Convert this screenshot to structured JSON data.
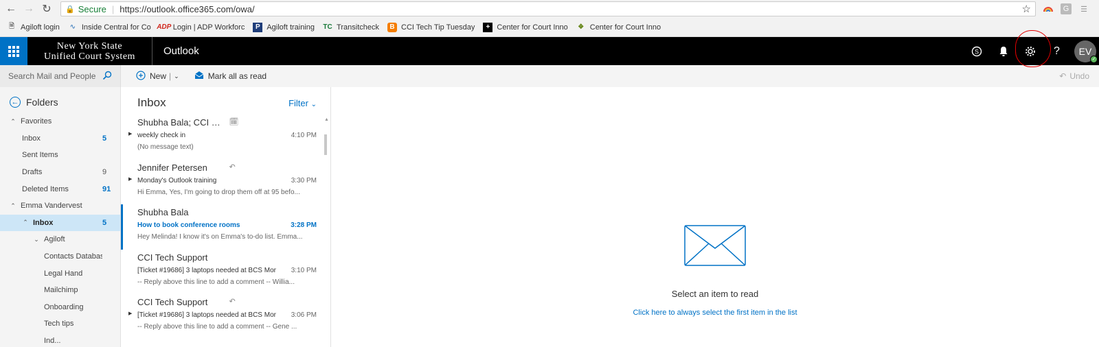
{
  "browser": {
    "secure_label": "Secure",
    "url": "https://outlook.office365.com/owa/",
    "bookmarks": [
      {
        "label": "Agiloft login",
        "icon": "page-icon"
      },
      {
        "label": "Inside Central for Co",
        "icon": "inside-central-icon"
      },
      {
        "label": "Login | ADP Workforc",
        "icon": "adp-icon"
      },
      {
        "label": "Agiloft training",
        "icon": "p-logo-icon"
      },
      {
        "label": "Transitcheck",
        "icon": "tc-icon"
      },
      {
        "label": "CCI Tech Tip Tuesday",
        "icon": "blogger-icon"
      },
      {
        "label": "Center for Court Inno",
        "icon": "plus-icon"
      },
      {
        "label": "Center for Court Inno",
        "icon": "ccci-icon"
      }
    ]
  },
  "suite": {
    "org_line1": "New York State",
    "org_line2": "Unified Court System",
    "app_name": "Outlook",
    "avatar_initials": "EV"
  },
  "commandbar": {
    "search_placeholder": "Search Mail and People",
    "new_label": "New",
    "mark_all_label": "Mark all as read",
    "undo_label": "Undo"
  },
  "folders": {
    "header": "Folders",
    "items": [
      {
        "label": "Favorites",
        "count": "",
        "level": 1,
        "chev": "^"
      },
      {
        "label": "Inbox",
        "count": "5",
        "level": 2,
        "blue": true
      },
      {
        "label": "Sent Items",
        "count": "",
        "level": 2
      },
      {
        "label": "Drafts",
        "count": "9",
        "level": 2
      },
      {
        "label": "Deleted Items",
        "count": "91",
        "level": 2,
        "blue": true
      },
      {
        "label": "Emma Vandervest",
        "count": "",
        "level": 1,
        "chev": "^"
      },
      {
        "label": "Inbox",
        "count": "5",
        "level": 2,
        "chev": "^",
        "selected": true,
        "blue": true
      },
      {
        "label": "Agiloft",
        "count": "",
        "level": 3,
        "chev": "v"
      },
      {
        "label": "Contacts Databas",
        "count": "",
        "level": 4
      },
      {
        "label": "Legal Hand",
        "count": "",
        "level": 4
      },
      {
        "label": "Mailchimp",
        "count": "",
        "level": 4
      },
      {
        "label": "Onboarding",
        "count": "",
        "level": 4
      },
      {
        "label": "Tech tips",
        "count": "",
        "level": 4
      },
      {
        "label": "Ind...",
        "count": "",
        "level": 4
      }
    ]
  },
  "inbox": {
    "title": "Inbox",
    "filter_label": "Filter",
    "messages": [
      {
        "from": "Shubha Bala; CCI Media Roo...",
        "subject": "weekly check in",
        "time": "4:10 PM",
        "preview": "(No message text)",
        "icon": "calendar-icon",
        "expand": true
      },
      {
        "from": "Jennifer Petersen",
        "subject": "Monday's Outlook training",
        "time": "3:30 PM",
        "preview": "Hi Emma,  Yes, I'm going to drop them off at 95 befo...",
        "icon": "reply-icon",
        "expand": true
      },
      {
        "from": "Shubha Bala",
        "subject": "How to book conference rooms",
        "time": "3:28 PM",
        "preview": "Hey Melinda!  I know it's on Emma's to-do list. Emma...",
        "icon": "",
        "selected": true
      },
      {
        "from": "CCI Tech Support",
        "subject": "[Ticket #19686] 3 laptops needed at BCS Mor",
        "time": "3:10 PM",
        "preview": "-- Reply above this line to add a comment --   Willia...",
        "icon": ""
      },
      {
        "from": "CCI Tech Support",
        "subject": "[Ticket #19686] 3 laptops needed at BCS Mor",
        "time": "3:06 PM",
        "preview": "-- Reply above this line to add a comment --   Gene ...",
        "icon": "reply-icon",
        "expand": true
      }
    ]
  },
  "reading": {
    "empty_text": "Select an item to read",
    "link_text": "Click here to always select the first item in the list"
  }
}
